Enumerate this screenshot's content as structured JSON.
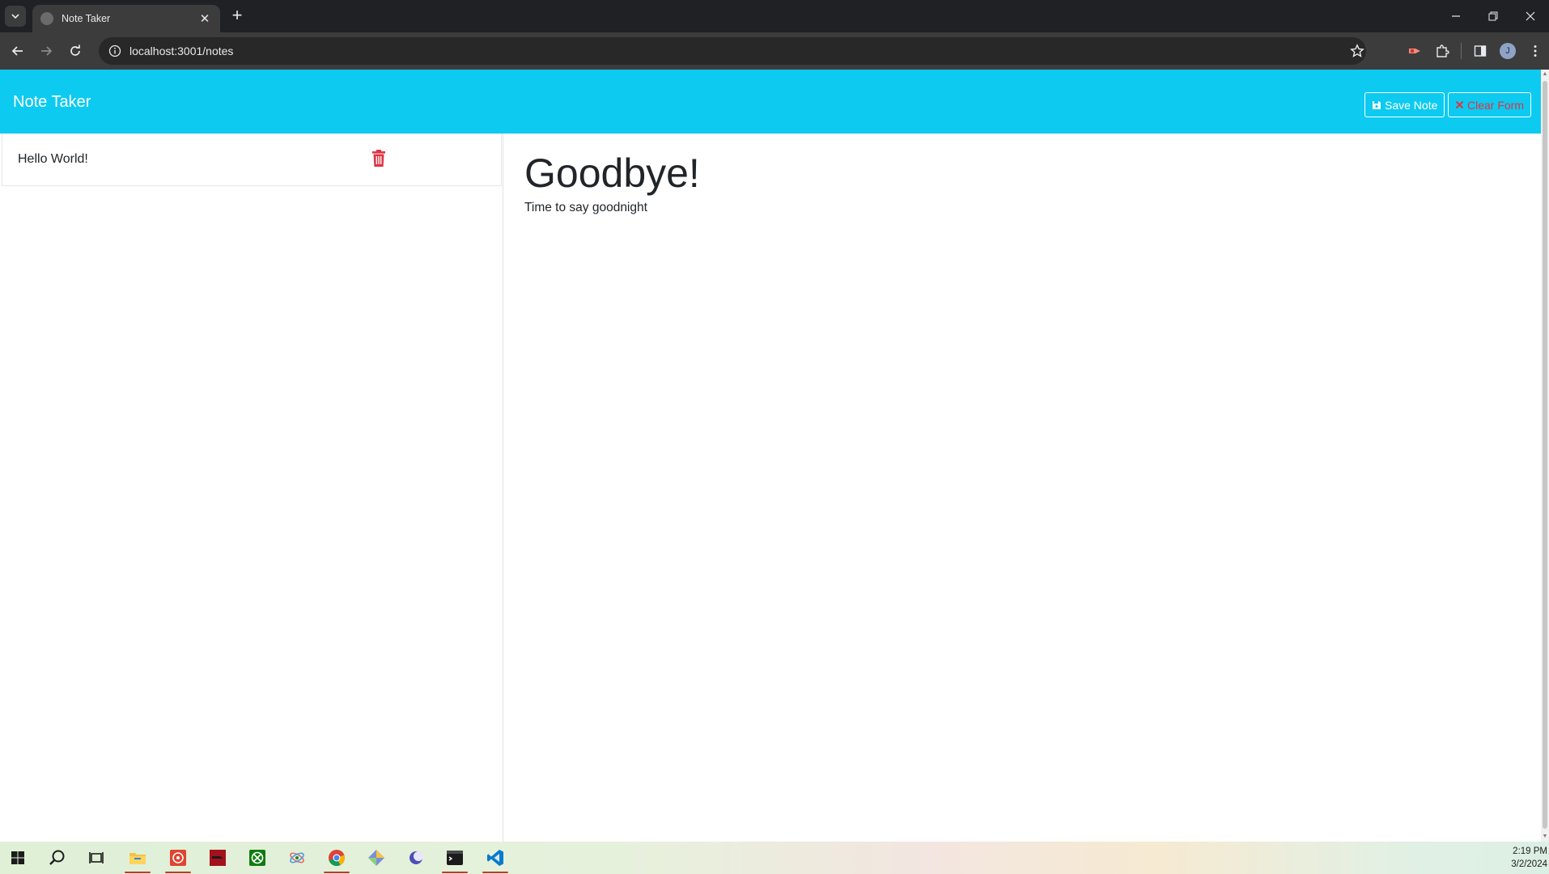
{
  "browser": {
    "tab_title": "Note Taker",
    "url": "localhost:3001/notes",
    "avatar_letter": "J"
  },
  "app": {
    "brand": "Note Taker",
    "save_label": "Save Note",
    "clear_label": "Clear Form",
    "accent": "#0dcaf0",
    "danger": "#dc3545"
  },
  "notes": [
    {
      "title": "Hello World!"
    }
  ],
  "active_note": {
    "title": "Goodbye!",
    "text": "Time to say goodnight"
  },
  "taskbar": {
    "apps": [
      "windows-start",
      "search",
      "task-view",
      "file-explorer",
      "app-red",
      "app-dark-red",
      "xbox",
      "app-feather",
      "chrome",
      "app-diamond",
      "app-moon",
      "terminal",
      "vscode"
    ],
    "time": "2:19 PM",
    "date": "3/2/2024"
  }
}
